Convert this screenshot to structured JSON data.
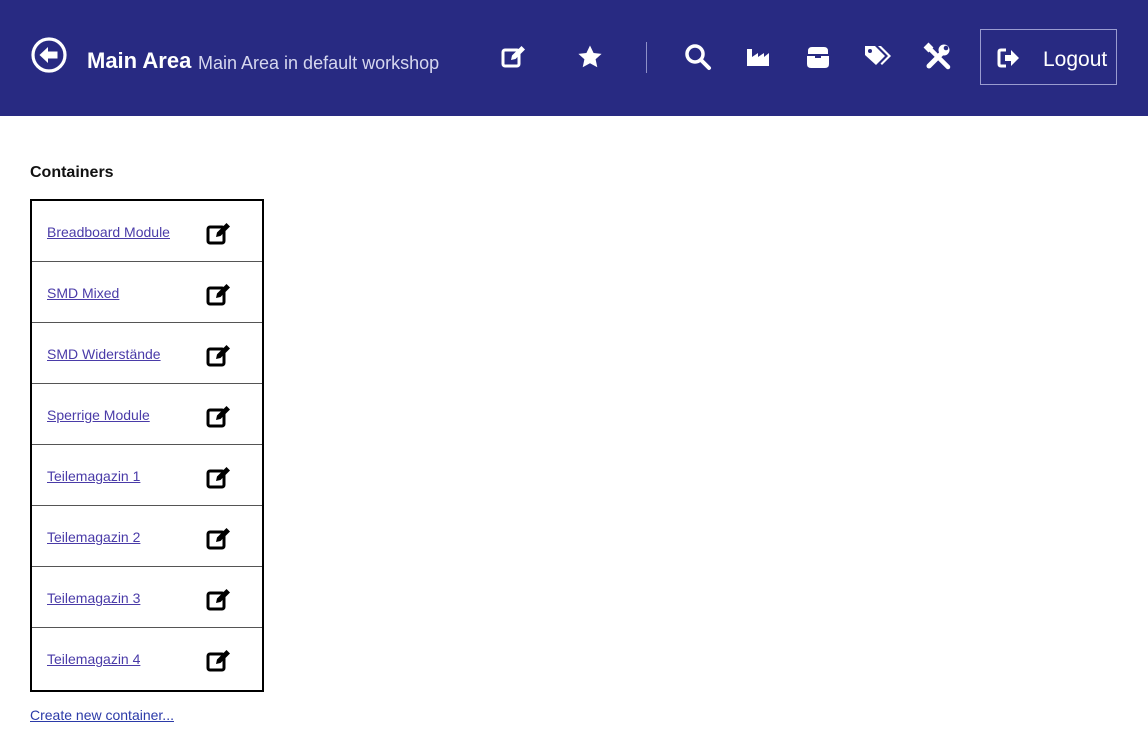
{
  "header": {
    "title": "Main Area",
    "subtitle": "Main Area in default workshop",
    "bg_color": "#282a82",
    "back_icon": "circle-arrow-left-icon",
    "tools": [
      {
        "name": "edit-icon"
      },
      {
        "name": "star-icon"
      },
      {
        "name": "search-icon"
      },
      {
        "name": "industry-icon"
      },
      {
        "name": "box-icon"
      },
      {
        "name": "tags-icon"
      },
      {
        "name": "tools-icon"
      }
    ],
    "logout_label": "Logout",
    "logout_icon": "sign-out-icon"
  },
  "main": {
    "section_title": "Containers",
    "containers": [
      {
        "label": "Breadboard Module"
      },
      {
        "label": "SMD Mixed"
      },
      {
        "label": "SMD Widerstände"
      },
      {
        "label": "Sperrige Module"
      },
      {
        "label": "Teilemagazin 1"
      },
      {
        "label": "Teilemagazin 2"
      },
      {
        "label": "Teilemagazin 3"
      },
      {
        "label": "Teilemagazin 4"
      }
    ],
    "create_link": "Create new container..."
  }
}
